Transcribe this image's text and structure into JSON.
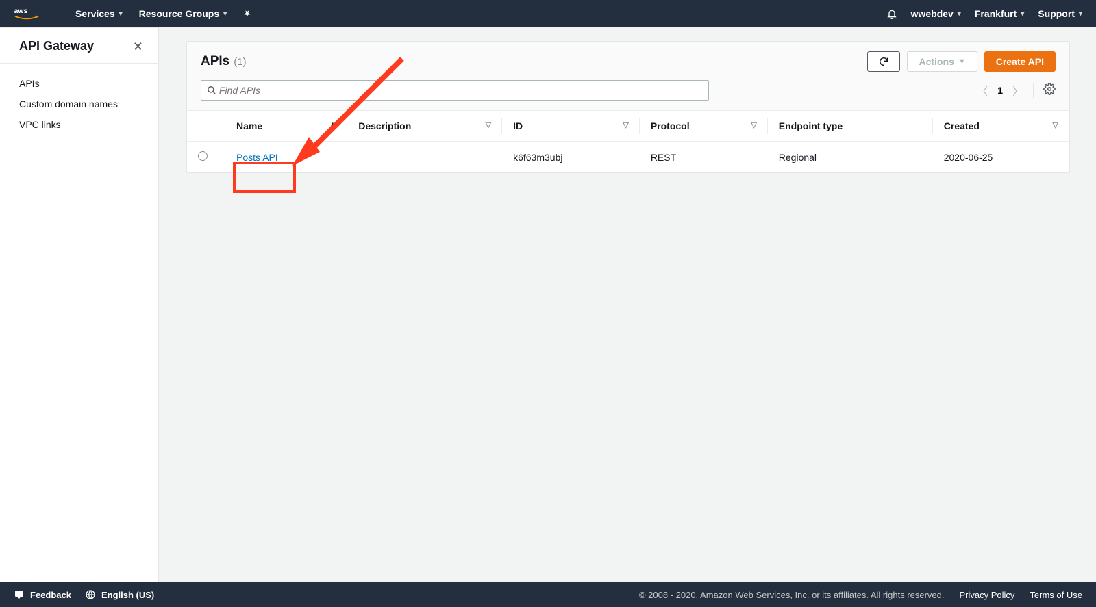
{
  "topnav": {
    "services": "Services",
    "resource_groups": "Resource Groups",
    "account": "wwebdev",
    "region": "Frankfurt",
    "support": "Support"
  },
  "sidebar": {
    "title": "API Gateway",
    "items": [
      {
        "label": "APIs"
      },
      {
        "label": "Custom domain names"
      },
      {
        "label": "VPC links"
      }
    ]
  },
  "main": {
    "title": "APIs",
    "count": "(1)",
    "actions": {
      "actions_label": "Actions",
      "create_label": "Create API"
    },
    "search_placeholder": "Find APIs",
    "page_number": "1",
    "columns": {
      "name": "Name",
      "description": "Description",
      "id": "ID",
      "protocol": "Protocol",
      "endpoint_type": "Endpoint type",
      "created": "Created"
    },
    "rows": [
      {
        "name": "Posts API",
        "description": "",
        "id": "k6f63m3ubj",
        "protocol": "REST",
        "endpoint_type": "Regional",
        "created": "2020-06-25"
      }
    ]
  },
  "footer": {
    "feedback": "Feedback",
    "language": "English (US)",
    "copyright": "© 2008 - 2020, Amazon Web Services, Inc. or its affiliates. All rights reserved.",
    "privacy": "Privacy Policy",
    "terms": "Terms of Use"
  }
}
